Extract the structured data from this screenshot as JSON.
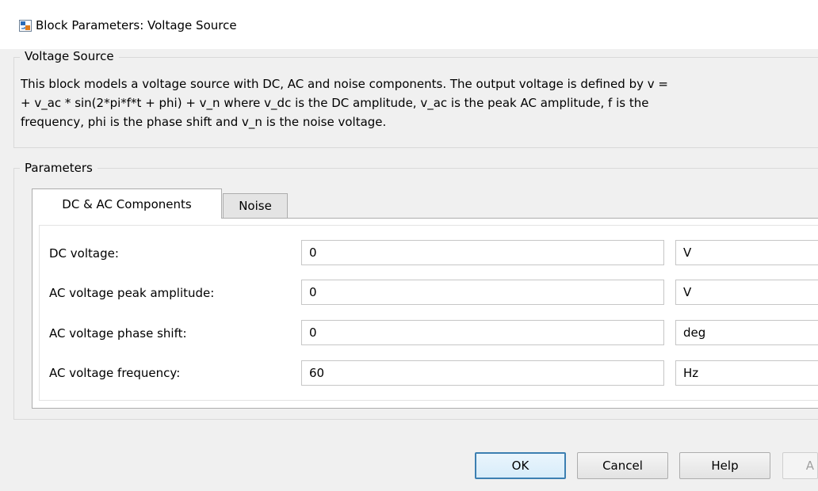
{
  "window": {
    "title": "Block Parameters: Voltage Source"
  },
  "block_group": {
    "legend": "Voltage Source",
    "description_lines": [
      "This block models a voltage source with DC, AC and noise components. The output voltage is defined by v =",
      "+ v_ac * sin(2*pi*f*t + phi) + v_n where v_dc is the DC amplitude, v_ac is the peak AC amplitude, f is the",
      "frequency, phi is the phase shift and v_n is the noise voltage."
    ]
  },
  "parameters_group": {
    "legend": "Parameters",
    "tabs": [
      {
        "label": "DC & AC Components",
        "active": true
      },
      {
        "label": "Noise",
        "active": false
      }
    ],
    "rows": [
      {
        "label": "DC voltage:",
        "value": "0",
        "unit": "V"
      },
      {
        "label": "AC voltage peak amplitude:",
        "value": "0",
        "unit": "V"
      },
      {
        "label": "AC voltage phase shift:",
        "value": "0",
        "unit": "deg"
      },
      {
        "label": "AC voltage frequency:",
        "value": "60",
        "unit": "Hz"
      }
    ]
  },
  "buttons": {
    "ok": "OK",
    "cancel": "Cancel",
    "help": "Help",
    "apply": "A"
  }
}
